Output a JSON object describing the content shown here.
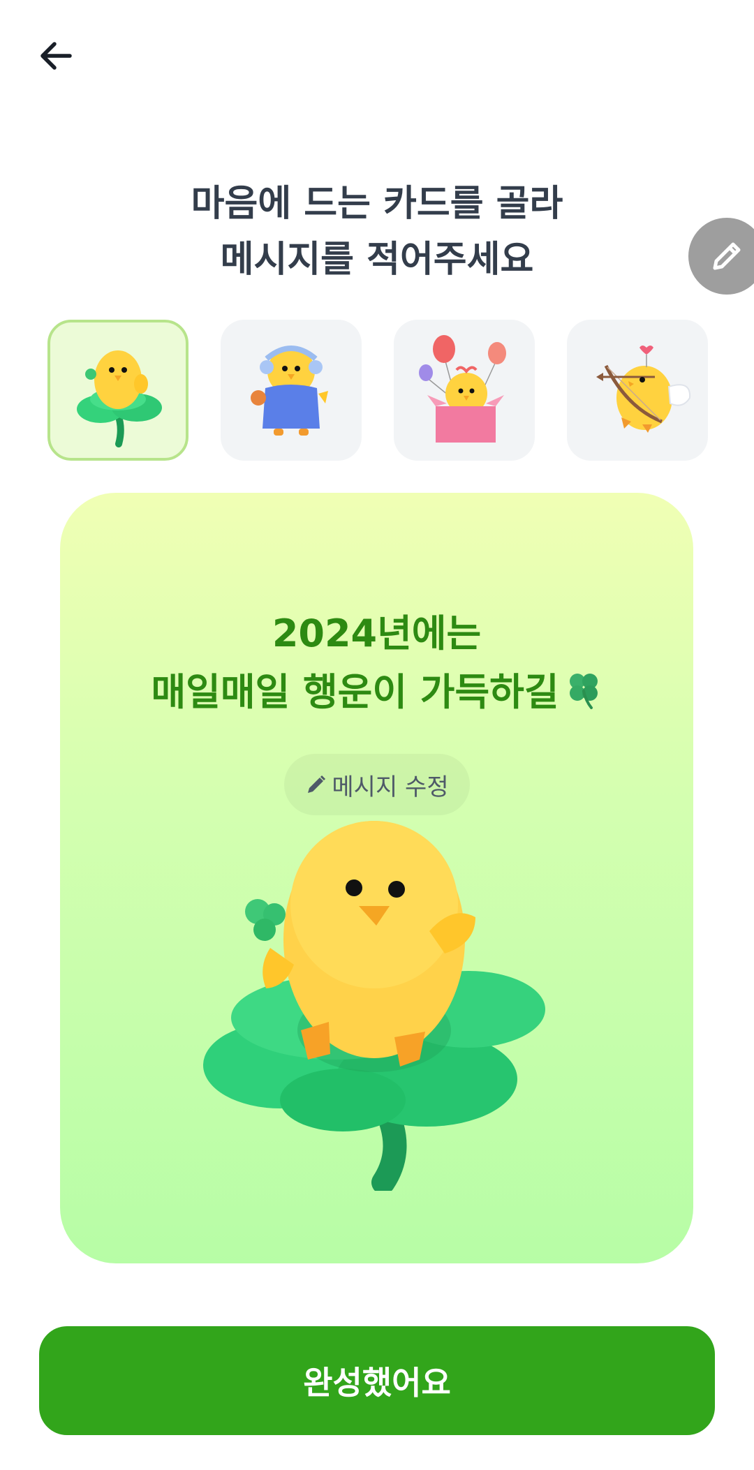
{
  "header": {
    "back_icon": "arrow-left-icon"
  },
  "headline": {
    "line1": "마음에 드는 카드를 골라",
    "line2": "메시지를 적어주세요"
  },
  "edit_fab": {
    "icon": "pencil-icon",
    "color": "#9e9e9e"
  },
  "thumbnails": [
    {
      "name": "chick-on-clover",
      "selected": true
    },
    {
      "name": "chick-in-blue-hoodie",
      "selected": false
    },
    {
      "name": "chick-in-gift-box-with-balloons",
      "selected": false
    },
    {
      "name": "chick-cupid-with-bow",
      "selected": false
    }
  ],
  "card": {
    "message_line1": "2024년에는",
    "message_line2": "매일매일 행운이 가득하길",
    "message_emoji": "clover-icon",
    "edit_message_label": "메시지 수정",
    "edit_message_icon": "pencil-icon",
    "text_color": "#2d8a12"
  },
  "footer": {
    "done_label": "완성했어요",
    "accent": "#32a51b"
  }
}
